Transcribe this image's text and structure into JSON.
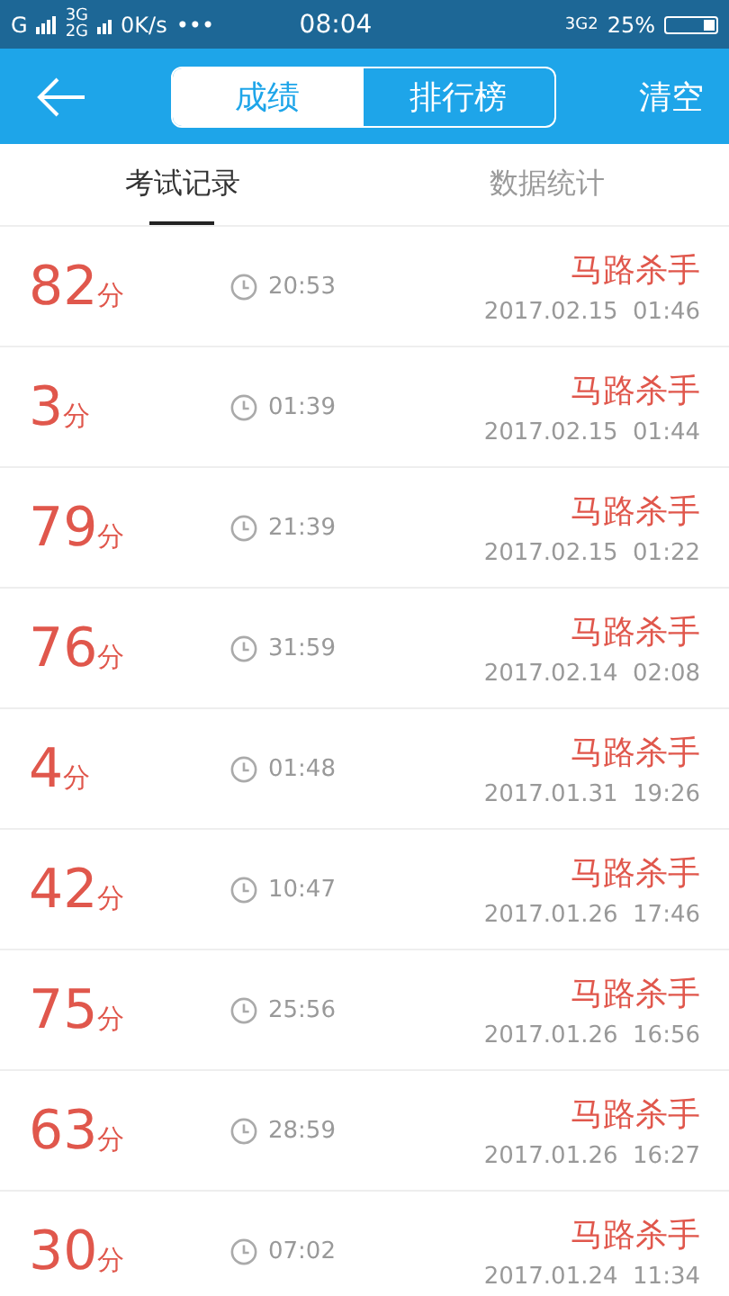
{
  "status_bar": {
    "left": [
      "G",
      "3G",
      "2G",
      "0K/s",
      "•••"
    ],
    "time": "08:04",
    "network": "3G2",
    "battery": "25%"
  },
  "header": {
    "segments": [
      {
        "label": "成绩",
        "selected": true
      },
      {
        "label": "排行榜",
        "selected": false
      }
    ],
    "action": "清空"
  },
  "tabs": [
    {
      "label": "考试记录",
      "selected": true
    },
    {
      "label": "数据统计",
      "selected": false
    }
  ],
  "records": [
    {
      "score": "82",
      "unit": "分",
      "duration": "20:53",
      "name": "马路杀手",
      "date": "2017.02.15  01:46"
    },
    {
      "score": "3",
      "unit": "分",
      "duration": "01:39",
      "name": "马路杀手",
      "date": "2017.02.15  01:44"
    },
    {
      "score": "79",
      "unit": "分",
      "duration": "21:39",
      "name": "马路杀手",
      "date": "2017.02.15  01:22"
    },
    {
      "score": "76",
      "unit": "分",
      "duration": "31:59",
      "name": "马路杀手",
      "date": "2017.02.14  02:08"
    },
    {
      "score": "4",
      "unit": "分",
      "duration": "01:48",
      "name": "马路杀手",
      "date": "2017.01.31  19:26"
    },
    {
      "score": "42",
      "unit": "分",
      "duration": "10:47",
      "name": "马路杀手",
      "date": "2017.01.26  17:46"
    },
    {
      "score": "75",
      "unit": "分",
      "duration": "25:56",
      "name": "马路杀手",
      "date": "2017.01.26  16:56"
    },
    {
      "score": "63",
      "unit": "分",
      "duration": "28:59",
      "name": "马路杀手",
      "date": "2017.01.26  16:27"
    },
    {
      "score": "30",
      "unit": "分",
      "duration": "07:02",
      "name": "马路杀手",
      "date": "2017.01.24  11:34"
    }
  ]
}
